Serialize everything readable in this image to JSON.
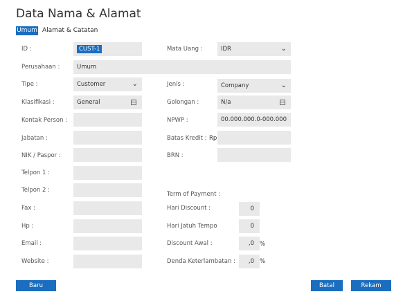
{
  "title": "Data Nama & Alamat",
  "tabs": [
    {
      "label": "Umum"
    },
    {
      "label": "Alamat & Catatan"
    }
  ],
  "left": {
    "id_label": "ID :",
    "id_value": "CUST-1",
    "perusahaan_label": "Perusahaan :",
    "perusahaan_value": "Umum",
    "tipe_label": "Tipe :",
    "tipe_value": "Customer",
    "klasifikasi_label": "Klasifikasi :",
    "klasifikasi_value": "General",
    "kontak_label": "Kontak Person :",
    "jabatan_label": "Jabatan :",
    "nik_label": "NIK / Paspor :",
    "telpon1_label": "Telpon 1 :",
    "telpon2_label": "Telpon 2 :",
    "fax_label": "Fax :",
    "hp_label": "Hp :",
    "email_label": "Email :",
    "website_label": "Website :"
  },
  "right": {
    "mata_uang_label": "Mata Uang :",
    "mata_uang_value": "IDR",
    "jenis_label": "Jenis :",
    "jenis_value": "Company",
    "golongan_label": "Golongan :",
    "golongan_value": "N/a",
    "npwp_label": "NPWP :",
    "npwp_value": "00.000.000.0-000.000",
    "batas_kredit_label": "Batas Kredit :",
    "batas_kredit_currency": "Rp",
    "brn_label": "BRN :",
    "term_label": "Term of Payment :",
    "hari_discount_label": "Hari Discount :",
    "hari_discount_value": "0",
    "jatuh_tempo_label": "Hari Jatuh Tempo",
    "jatuh_tempo_value": "0",
    "discount_awal_label": "Discount Awal :",
    "discount_awal_value": ",0",
    "denda_label": "Denda Keterlambatan :",
    "denda_value": ",0",
    "percent": "%"
  },
  "buttons": {
    "baru": "Baru",
    "batal": "Batal",
    "rekam": "Rekam"
  },
  "colors": {
    "accent": "#1a6dbf",
    "field_bg": "#e9e9e9"
  },
  "icons": {
    "dropdown": "chevron-down-icon",
    "lookup": "list-lookup-icon"
  }
}
